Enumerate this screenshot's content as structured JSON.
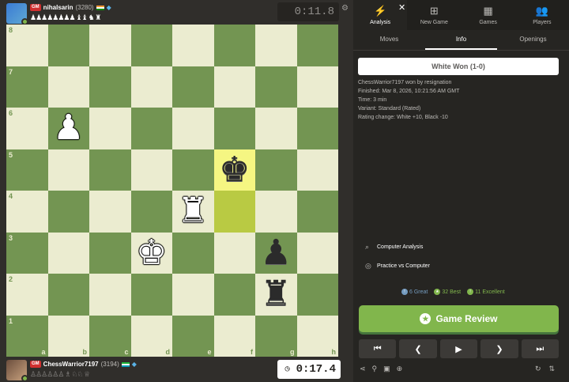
{
  "top_player": {
    "title": "GM",
    "name": "nihalsarin",
    "rating": "(3280)",
    "captured": "♟♟♟♟♟♟♟♟ ♝♝ ♞ ♜",
    "clock": "0:11.8"
  },
  "bottom_player": {
    "title": "GM",
    "name": "ChessWarrior7197",
    "rating": "(3194)",
    "captured": "♙♙♙♙♙♙ ♗ ♘♘ ♕",
    "clock": "0:17.4"
  },
  "board": {
    "ranks": [
      "8",
      "7",
      "6",
      "5",
      "4",
      "3",
      "2",
      "1"
    ],
    "files": [
      "a",
      "b",
      "c",
      "d",
      "e",
      "f",
      "g",
      "h"
    ],
    "pieces": [
      {
        "square": "b6",
        "glyph": "♟",
        "color": "white"
      },
      {
        "square": "f5",
        "glyph": "♚",
        "color": "black"
      },
      {
        "square": "e4",
        "glyph": "♜",
        "color": "white"
      },
      {
        "square": "d3",
        "glyph": "♚",
        "color": "white"
      },
      {
        "square": "g3",
        "glyph": "♟",
        "color": "black"
      },
      {
        "square": "g2",
        "glyph": "♜",
        "color": "black"
      }
    ],
    "highlighted": [
      "f5",
      "f4"
    ],
    "colors": {
      "light": "#ebecd0",
      "dark": "#739552",
      "highlight_light": "#f5f682",
      "highlight_dark": "#b9ca43"
    }
  },
  "main_tabs": [
    {
      "label": "Analysis",
      "icon": "lightning-icon",
      "glyph": "⚡",
      "active": true
    },
    {
      "label": "New Game",
      "icon": "plus-square-icon",
      "glyph": "⊞",
      "active": false
    },
    {
      "label": "Games",
      "icon": "board-icon",
      "glyph": "▦",
      "active": false
    },
    {
      "label": "Players",
      "icon": "people-icon",
      "glyph": "👥",
      "active": false
    }
  ],
  "sub_tabs": [
    {
      "label": "Moves",
      "active": false
    },
    {
      "label": "Info",
      "active": true
    },
    {
      "label": "Openings",
      "active": false
    }
  ],
  "info": {
    "result": "White Won (1-0)",
    "lines": [
      "ChessWarrior7197 won by resignation",
      "Finished: Mar 8, 2026, 10:21:56 AM GMT",
      "Time: 3 min",
      "Variant: Standard (Rated)",
      "Rating change: White +10, Black -10"
    ]
  },
  "tools": {
    "computer_analysis": "Computer Analysis",
    "practice": "Practice vs Computer"
  },
  "stats": {
    "great": "6 Great",
    "best": "32 Best",
    "excellent": "11 Excellent"
  },
  "review_label": "Game Review",
  "accent": "#81b64c"
}
